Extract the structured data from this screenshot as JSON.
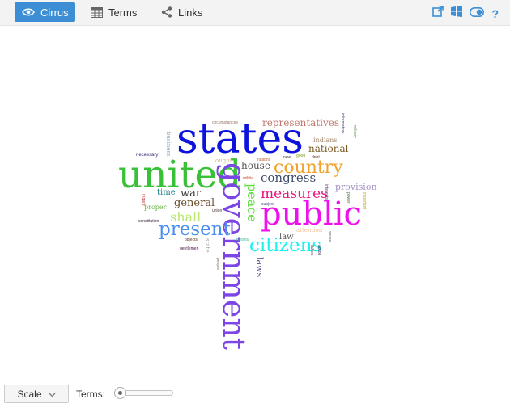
{
  "toolbar": {
    "tabs": [
      {
        "label": "Cirrus",
        "icon": "eye-icon",
        "active": true
      },
      {
        "label": "Terms",
        "icon": "table-icon",
        "active": false
      },
      {
        "label": "Links",
        "icon": "share-nodes-icon",
        "active": false
      }
    ],
    "tools": [
      "export-icon",
      "windows-icon",
      "toggle-icon",
      "help-icon"
    ],
    "help_glyph": "?",
    "accent_color": "#3d8fd5"
  },
  "cloud": {
    "words": [
      {
        "text": "states",
        "color": "#0c13dd"
      },
      {
        "text": "united",
        "color": "#38c036"
      },
      {
        "text": "government",
        "color": "#7b46e4"
      },
      {
        "text": "public",
        "color": "#ee11ee"
      },
      {
        "text": "country",
        "color": "#f2a12d"
      },
      {
        "text": "citizens",
        "color": "#1cf0f0"
      },
      {
        "text": "present",
        "color": "#4a8ff0"
      },
      {
        "text": "measures",
        "color": "#e8157f"
      },
      {
        "text": "congress",
        "color": "#3f4f6a"
      },
      {
        "text": "representatives",
        "color": "#c2776c"
      },
      {
        "text": "shall",
        "color": "#b8e86c"
      },
      {
        "text": "peace",
        "color": "#5cdd3c"
      },
      {
        "text": "general",
        "color": "#6b4c2c"
      },
      {
        "text": "national",
        "color": "#7a5a20"
      },
      {
        "text": "house",
        "color": "#555555"
      },
      {
        "text": "war",
        "color": "#3b3b3b"
      },
      {
        "text": "provision",
        "color": "#a38ec4"
      },
      {
        "text": "laws",
        "color": "#4b4b85"
      },
      {
        "text": "time",
        "color": "#1f7f8c"
      },
      {
        "text": "law",
        "color": "#555555"
      },
      {
        "text": "proper",
        "color": "#6cb84e"
      },
      {
        "text": "indians",
        "color": "#a58c6c"
      },
      {
        "text": "attention",
        "color": "#f6c29a"
      },
      {
        "text": "ought",
        "color": "#d3b98a"
      },
      {
        "text": "necessary",
        "color": "#3b2a78"
      },
      {
        "text": "state",
        "color": "#9a9a9a"
      },
      {
        "text": "business",
        "color": "#8aa6c2"
      },
      {
        "text": "circumstances",
        "color": "#9a7a6a"
      },
      {
        "text": "information",
        "color": "#3a3a6a"
      },
      {
        "text": "military",
        "color": "#6a8a4a"
      },
      {
        "text": "nations",
        "color": "#b85a2a"
      },
      {
        "text": "debt",
        "color": "#6a2a2a"
      },
      {
        "text": "objects",
        "color": "#5a3a2a"
      },
      {
        "text": "gentlemen",
        "color": "#4a1a4a"
      },
      {
        "text": "constitution",
        "color": "#3a1a3a"
      },
      {
        "text": "subject",
        "color": "#4a4a8a"
      },
      {
        "text": "militia",
        "color": "#c24a2a"
      },
      {
        "text": "union",
        "color": "#4a2a2a"
      },
      {
        "text": "people",
        "color": "#8a6a4a"
      },
      {
        "text": "means",
        "color": "#3ab89a"
      },
      {
        "text": "new",
        "color": "#3a3a3a"
      },
      {
        "text": "good",
        "color": "#7a9a1a"
      },
      {
        "text": "duties",
        "color": "#4a4a4a"
      },
      {
        "text": "interests",
        "color": "#5a2a7a"
      },
      {
        "text": "important",
        "color": "#c2a22a"
      },
      {
        "text": "sense",
        "color": "#6a6a6a"
      },
      {
        "text": "action",
        "color": "#2a2a4a"
      },
      {
        "text": "power",
        "color": "#4a6a2a"
      },
      {
        "text": "regard",
        "color": "#c23a3a"
      }
    ]
  },
  "footer": {
    "scale_label": "Scale",
    "terms_label": "Terms:",
    "terms_slider_fraction": 0.05
  }
}
